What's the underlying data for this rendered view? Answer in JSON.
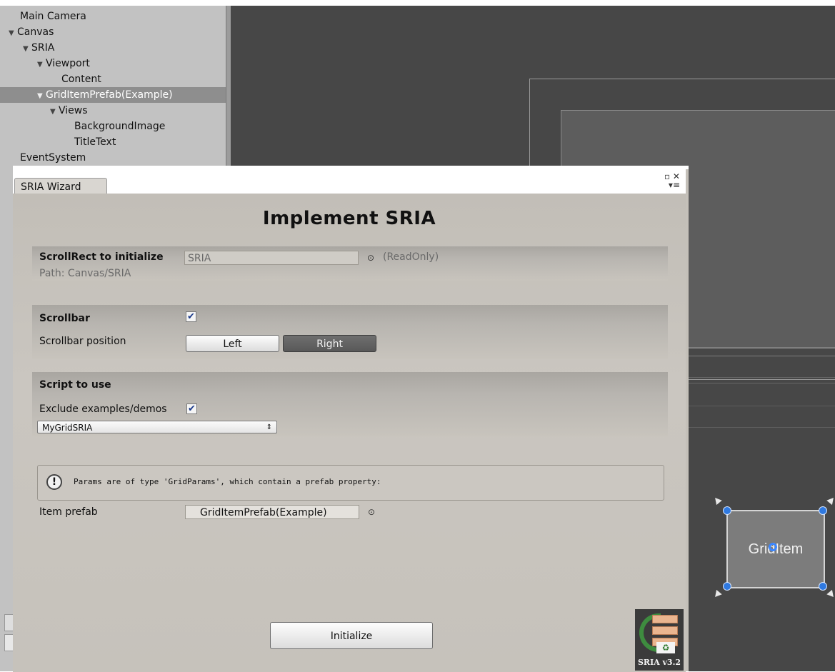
{
  "hierarchy": {
    "items": [
      {
        "label": "Main Camera",
        "expander": ""
      },
      {
        "label": "Canvas",
        "expander": "▼"
      },
      {
        "label": "SRIA",
        "expander": "▼"
      },
      {
        "label": "Viewport",
        "expander": "▼"
      },
      {
        "label": "Content",
        "expander": ""
      },
      {
        "label": "GridItemPrefab(Example)",
        "expander": "▼"
      },
      {
        "label": "Views",
        "expander": "▼"
      },
      {
        "label": "BackgroundImage",
        "expander": ""
      },
      {
        "label": "TitleText",
        "expander": ""
      },
      {
        "label": "EventSystem",
        "expander": ""
      }
    ],
    "selected": "GridItemPrefab(Example)"
  },
  "scene": {
    "grid_item_text": "GridItem"
  },
  "wizard": {
    "tab_label": "SRIA Wizard",
    "title": "Implement SRIA",
    "scrollrect": {
      "label": "ScrollRect to initialize",
      "value": "SRIA",
      "readonly_note": "(ReadOnly)",
      "path": "Path: Canvas/SRIA"
    },
    "scrollbar": {
      "label": "Scrollbar",
      "checked": true,
      "position_label": "Scrollbar position",
      "options": [
        "Left",
        "Right"
      ],
      "selected": "Right"
    },
    "script": {
      "label": "Script to use",
      "exclude_label": "Exclude examples/demos",
      "exclude_checked": true,
      "selected_script": "MyGridSRIA",
      "help_text": "Params are of type 'GridParams', which contain a prefab property:",
      "item_prefab_label": "Item prefab",
      "item_prefab_value": "GridItemPrefab(Example)"
    },
    "initialize_label": "Initialize",
    "logo_text": "SRIA v3.2",
    "checkmark": "✔",
    "help_icon": "!",
    "target_glyph": "⊙",
    "dropdown_arrow": "⇕",
    "window_controls": [
      "▫ ✕",
      "▾≡"
    ]
  }
}
